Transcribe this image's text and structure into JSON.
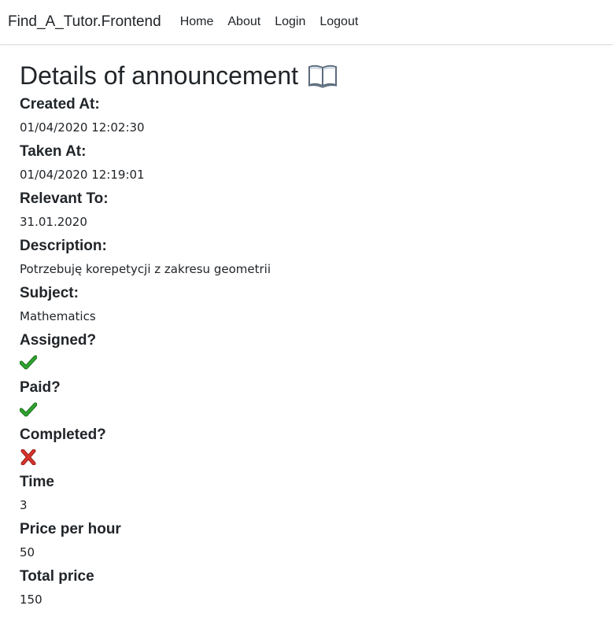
{
  "navbar": {
    "brand": "Find_A_Tutor.Frontend",
    "links": [
      "Home",
      "About",
      "Login",
      "Logout"
    ]
  },
  "page": {
    "title": "Details of announcement",
    "title_icon": "open-book-icon"
  },
  "details": {
    "created_at_label": "Created At:",
    "created_at": "01/04/2020 12:02:30",
    "taken_at_label": "Taken At:",
    "taken_at": "01/04/2020 12:19:01",
    "relevant_to_label": "Relevant To:",
    "relevant_to": "31.01.2020",
    "description_label": "Description:",
    "description": "Potrzebuję korepetycji z zakresu geometrii",
    "subject_label": "Subject:",
    "subject": "Mathematics",
    "assigned_label": "Assigned?",
    "assigned_icon": "check-mark-icon",
    "paid_label": "Paid?",
    "paid_icon": "check-mark-icon",
    "completed_label": "Completed?",
    "completed_icon": "cross-mark-icon",
    "time_label": "Time",
    "time": "3",
    "price_per_hour_label": "Price per hour",
    "price_per_hour": "50",
    "total_price_label": "Total price",
    "total_price": "150"
  },
  "colors": {
    "check": "#2fa52f",
    "cross": "#d9342b"
  }
}
